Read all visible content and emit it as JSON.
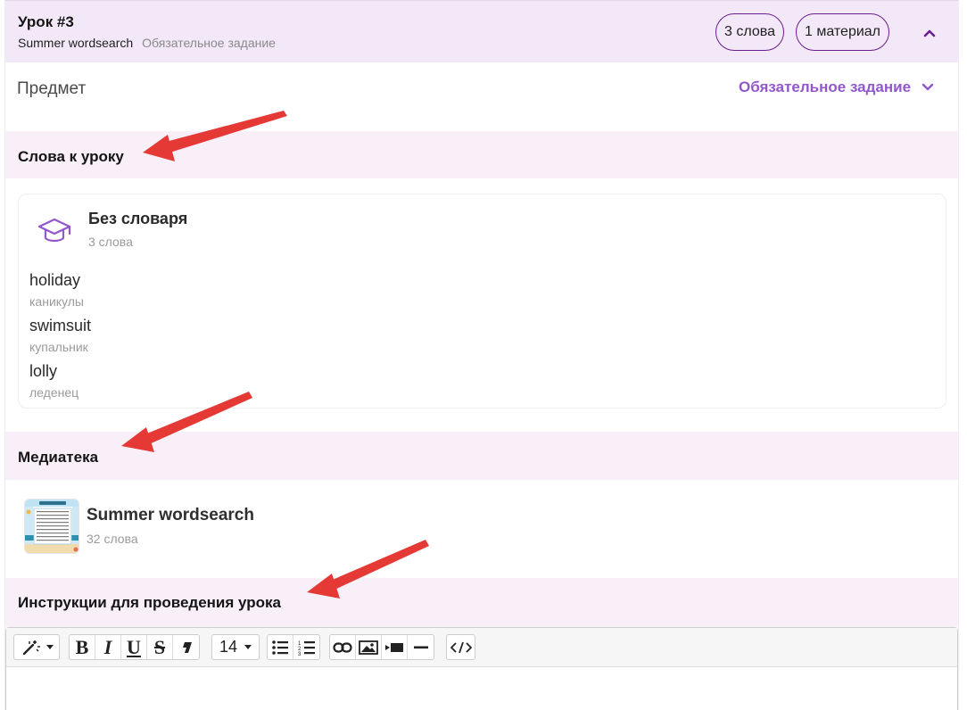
{
  "lesson": {
    "title": "Урок #3",
    "subtitle": "Summer wordsearch",
    "subtitle_type": "Обязательное задание",
    "words_pill": "3 слова",
    "materials_pill": "1 материал"
  },
  "subject": {
    "label": "Предмет",
    "task_type": "Обязательное задание"
  },
  "sections": {
    "words_title": "Слова к уроку",
    "media_title": "Медиатека",
    "instructions_title": "Инструкции для проведения урока"
  },
  "dictionary": {
    "title": "Без словаря",
    "count": "3 слова",
    "icon": "graduation-cap-icon",
    "words": [
      {
        "word": "holiday",
        "translation": "каникулы"
      },
      {
        "word": "swimsuit",
        "translation": "купальник"
      },
      {
        "word": "lolly",
        "translation": "леденец"
      }
    ]
  },
  "media": {
    "title": "Summer wordsearch",
    "count": "32 слова"
  },
  "editor": {
    "font_size": "14",
    "tools": [
      "magic-wand",
      "bold",
      "italic",
      "underline",
      "strikethrough",
      "eraser",
      "font-size",
      "unordered-list",
      "ordered-list",
      "link",
      "image",
      "video",
      "horizontal-rule",
      "code-view"
    ]
  },
  "colors": {
    "header_bg": "#f3e8f8",
    "band_bg": "#f8eff9",
    "accent": "#9357cc",
    "pill_border": "#6a1f8c",
    "annotation_arrow": "#e53935"
  }
}
